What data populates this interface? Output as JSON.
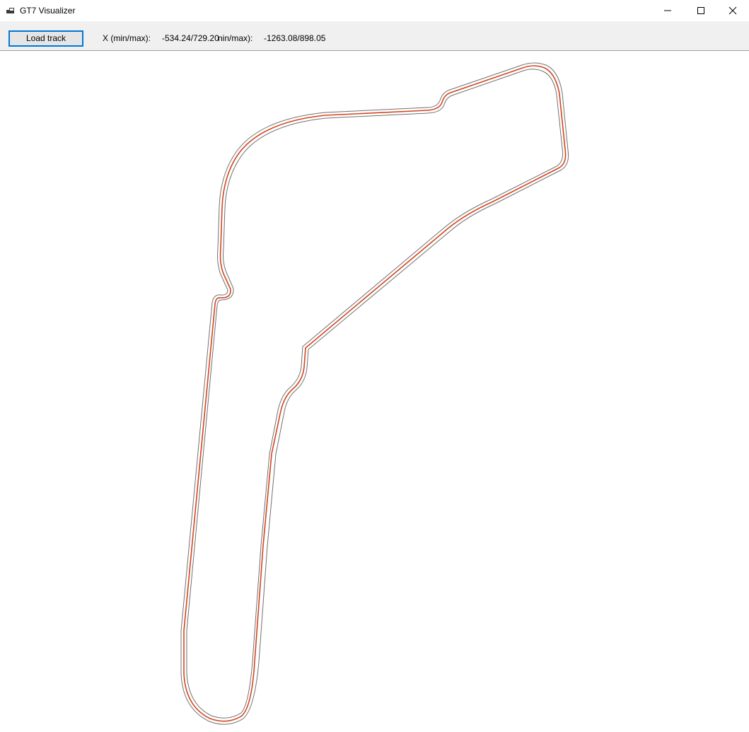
{
  "window": {
    "title": "GT7 Visualizer",
    "icons": {
      "app": "app-window-icon",
      "minimize": "minimize-icon",
      "maximize": "maximize-icon",
      "close": "close-icon"
    }
  },
  "toolbar": {
    "load_label": "Load track",
    "x_label": "X (min/max):",
    "x_value": "-534.24/729.20",
    "y_label": "nin/max):",
    "y_value": "-1263.08/898.05"
  },
  "track": {
    "colors": {
      "boundary": "#707070",
      "racing_line": "#d2451e"
    }
  }
}
